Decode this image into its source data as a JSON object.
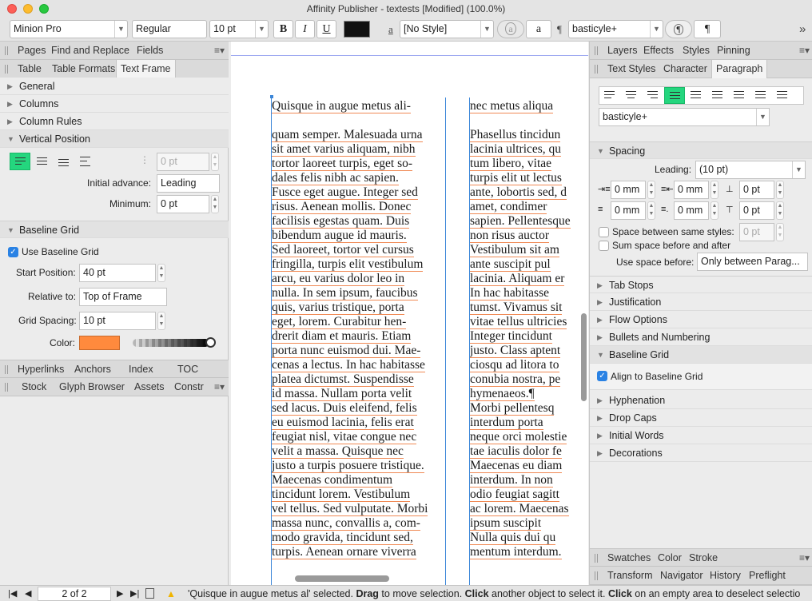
{
  "window": {
    "title": "Affinity Publisher - textests [Modified] (100.0%)"
  },
  "toolbar": {
    "font": "Minion Pro",
    "style": "Regular",
    "size": "10 pt",
    "bold": "B",
    "italic": "I",
    "underline": "U",
    "char_style_glyph": "a",
    "char_style": "[No Style]",
    "para_glyph": "¶",
    "para_style": "basticyle+",
    "more": "»",
    "text_color": "#111111"
  },
  "left_panel": {
    "tabs_top": [
      "Pages",
      "Find and Replace",
      "Fields"
    ],
    "tabs_second": [
      "Table",
      "Table Formats",
      "Text Frame"
    ],
    "active_tab": "Text Frame",
    "sections": [
      "General",
      "Columns",
      "Column Rules",
      "Vertical Position"
    ],
    "vertical_position": {
      "disabled_value": "0 pt",
      "initial_advance_label": "Initial advance:",
      "initial_advance_value": "Leading",
      "minimum_label": "Minimum:",
      "minimum_value": "0 pt"
    },
    "baseline_grid": {
      "title": "Baseline Grid",
      "use_label": "Use Baseline Grid",
      "start_position_label": "Start Position:",
      "start_position_value": "40 pt",
      "relative_to_label": "Relative to:",
      "relative_to_value": "Top of Frame",
      "grid_spacing_label": "Grid Spacing:",
      "grid_spacing_value": "10 pt",
      "color_label": "Color:",
      "color_hex": "#ff8a3d"
    },
    "tabs_bottom1": [
      "Hyperlinks",
      "Anchors",
      "Index",
      "TOC"
    ],
    "tabs_bottom2": [
      "Stock",
      "Glyph Browser",
      "Assets",
      "Constr"
    ]
  },
  "document": {
    "column1": [
      "Quisque in augue metus ali-",
      "",
      "quam semper. Malesuada urna",
      "sit amet varius aliquam, nibh",
      "tortor laoreet turpis, eget so-",
      "dales felis nibh ac sapien.",
      "Fusce eget augue. Integer sed",
      "risus. Aenean mollis. Donec",
      "facilisis egestas quam. Duis",
      "bibendum augue id mauris.",
      "Sed laoreet, tortor vel cursus",
      "fringilla, turpis elit vestibulum",
      "arcu, eu varius dolor leo in",
      "nulla. In sem ipsum, faucibus",
      "quis, varius tristique, porta",
      "eget, lorem. Curabitur hen-",
      "drerit diam et mauris. Etiam",
      "porta nunc euismod dui. Mae-",
      "cenas a lectus. In hac habitasse",
      "platea dictumst. Suspendisse",
      "id massa. Nullam porta velit",
      "sed lacus. Duis eleifend, felis",
      "eu euismod lacinia, felis erat",
      "feugiat nisl, vitae congue nec",
      "velit a massa. Quisque nec",
      "justo a turpis posuere tristique.",
      "   Maecenas condimentum",
      "tincidunt lorem. Vestibulum",
      "vel tellus. Sed vulputate. Morbi",
      "massa nunc, convallis a, com-",
      "modo gravida, tincidunt sed,",
      "turpis. Aenean ornare viverra"
    ],
    "column2": [
      "nec metus aliqua",
      "",
      "Phasellus tincidun",
      "lacinia ultrices, qu",
      "tum libero, vitae",
      "turpis elit ut lectus",
      "ante, lobortis sed, d",
      "amet, condimer",
      "sapien. Pellentesque",
      "non risus auctor",
      "Vestibulum sit am",
      "ante suscipit pul",
      "lacinia. Aliquam er",
      "In hac habitasse",
      "tumst. Vivamus sit",
      "vitae tellus ultricies",
      "Integer tincidunt",
      "justo. Class aptent",
      "ciosqu ad litora to",
      "conubia nostra, pe",
      "hymenaeos.¶",
      "   Morbi pellentesq",
      "interdum porta",
      "neque orci molestie",
      "tae iaculis dolor fe",
      "Maecenas eu diam",
      "interdum. In non",
      "odio feugiat sagitt",
      "ac lorem. Maecenas",
      "ipsum suscipit",
      "Nulla quis dui qu",
      "mentum interdum."
    ]
  },
  "right_panel": {
    "tabs_top": [
      "Layers",
      "Effects",
      "Styles",
      "Pinning"
    ],
    "tabs_second": [
      "Text Styles",
      "Character",
      "Paragraph"
    ],
    "active_tab": "Paragraph",
    "para_style": "basticyle+",
    "spacing": {
      "title": "Spacing",
      "leading_label": "Leading:",
      "leading_value": "(10 pt)",
      "left_indent": "0 mm",
      "first_indent": "0 mm",
      "space_before": "0 pt",
      "right_indent": "0 mm",
      "last_indent": "0 mm",
      "space_after": "0 pt",
      "same_styles_label": "Space between same styles:",
      "same_styles_value": "0 pt",
      "sum_label": "Sum space before and after",
      "use_before_label": "Use space before:",
      "use_before_value": "Only between Parag..."
    },
    "sections_after": [
      "Tab Stops",
      "Justification",
      "Flow Options",
      "Bullets and Numbering"
    ],
    "baseline_grid_title": "Baseline Grid",
    "align_label": "Align to Baseline Grid",
    "sections_end": [
      "Hyphenation",
      "Drop Caps",
      "Initial Words",
      "Decorations"
    ],
    "tabs_bottom1": [
      "Swatches",
      "Color",
      "Stroke"
    ],
    "tabs_bottom2": [
      "Transform",
      "Navigator",
      "History",
      "Preflight"
    ]
  },
  "status": {
    "page": "2 of 2",
    "msg_1": "'Quisque in augue metus al' selected. ",
    "msg_b1": "Drag",
    "msg_2": " to move selection. ",
    "msg_b2": "Click",
    "msg_3": " another object to select it. ",
    "msg_b3": "Click",
    "msg_4": " on an empty area to deselect selectio"
  }
}
